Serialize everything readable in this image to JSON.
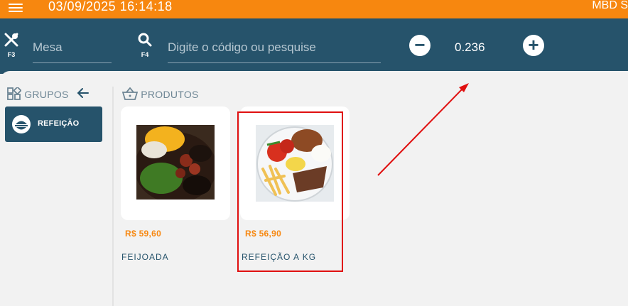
{
  "topbar": {
    "datetime": "03/09/2025 16:14:18",
    "company": "MBD S"
  },
  "header": {
    "mesa": {
      "key": "F3",
      "placeholder": "Mesa"
    },
    "search": {
      "key": "F4",
      "placeholder": "Digite o código ou pesquise"
    },
    "quantity": "0.236"
  },
  "groups": {
    "title": "GRUPOS",
    "items": [
      {
        "label": "REFEIÇÃO"
      }
    ]
  },
  "products": {
    "title": "PRODUTOS",
    "items": [
      {
        "price": "R$ 59,60",
        "name": "FEIJOADA"
      },
      {
        "price": "R$ 56,90",
        "name": "REFEIÇÃO A KG"
      }
    ]
  },
  "colors": {
    "orange": "#f7870f",
    "navy": "#26536b",
    "highlight": "#e01010"
  }
}
